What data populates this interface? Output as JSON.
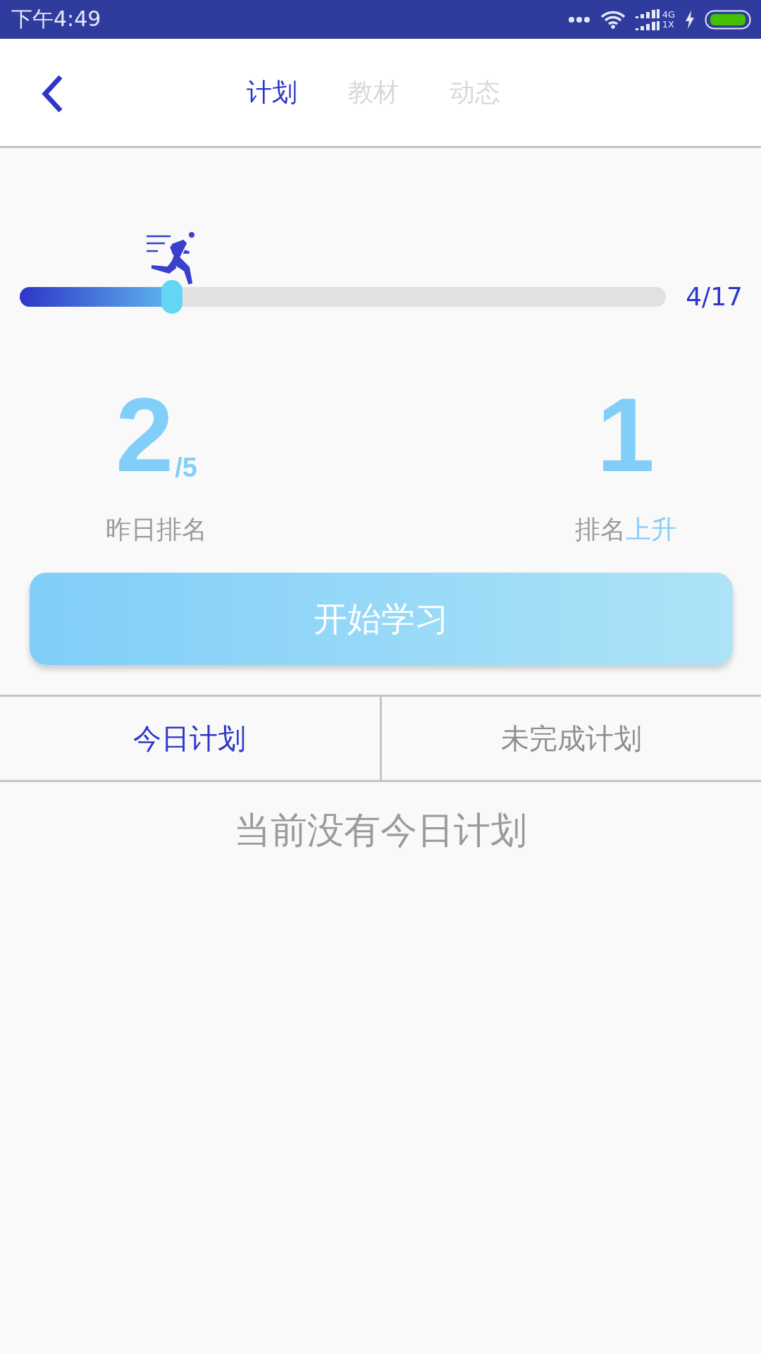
{
  "status_bar": {
    "time": "下午4:49",
    "network_top": "4G",
    "network_bottom": "1X"
  },
  "header": {
    "tabs": [
      {
        "label": "计划",
        "selected": true
      },
      {
        "label": "教材",
        "selected": false
      },
      {
        "label": "动态",
        "selected": false
      }
    ]
  },
  "progress": {
    "level": 0.235,
    "reading": "4/17"
  },
  "stats": [
    {
      "value": "2",
      "suffix": "/5",
      "label": "昨日排名"
    },
    {
      "value": "1",
      "label": "排名",
      "label_highlight": "上升"
    }
  ],
  "start_button": "开始学习",
  "plan_tabs": [
    {
      "label": "今日计划",
      "selected": true
    },
    {
      "label": "未完成计划",
      "selected": false
    }
  ],
  "empty_message": "当前没有今日计划"
}
